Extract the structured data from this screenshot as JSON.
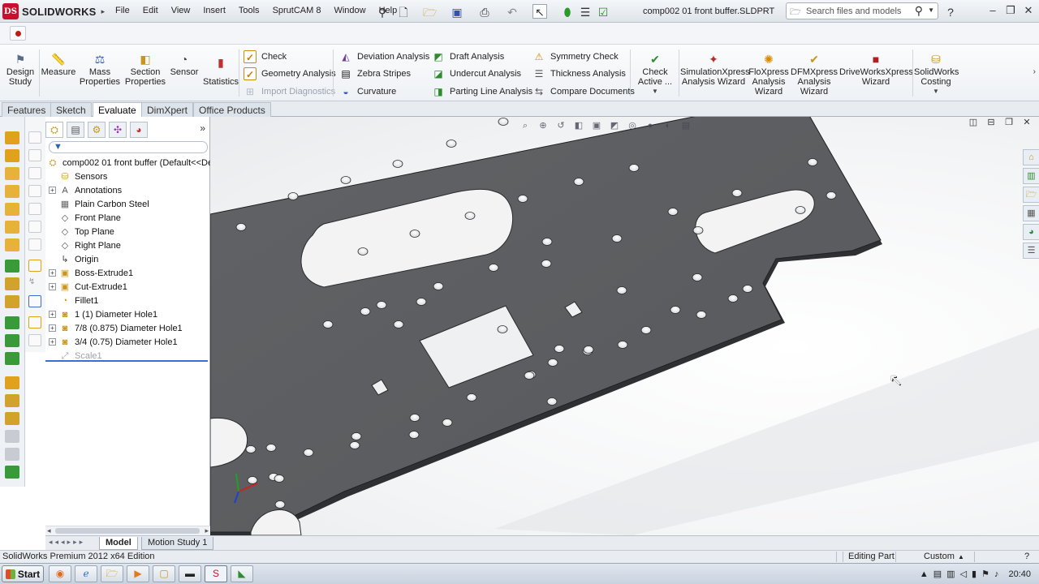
{
  "app": {
    "name": "SOLIDWORKS",
    "logo_mark": "DS",
    "document_title": "comp002 01 front buffer.SLDPRT"
  },
  "menu": [
    "File",
    "Edit",
    "View",
    "Insert",
    "Tools",
    "SprutCAM 8",
    "Window",
    "Help"
  ],
  "search": {
    "placeholder": "Search files and models"
  },
  "ribbon": {
    "large_buttons": [
      {
        "label1": "Design",
        "label2": "Study",
        "icon": "design-study-icon"
      },
      {
        "label1": "Measure",
        "label2": "",
        "icon": "measure-icon"
      },
      {
        "label1": "Mass",
        "label2": "Properties",
        "icon": "mass-properties-icon"
      },
      {
        "label1": "Section",
        "label2": "Properties",
        "icon": "section-properties-icon"
      },
      {
        "label1": "Sensor",
        "label2": "",
        "icon": "sensor-icon"
      },
      {
        "label1": "Statistics",
        "label2": "",
        "icon": "statistics-icon"
      }
    ],
    "col1": [
      {
        "label": "Check",
        "icon": "check-icon",
        "enabled": true
      },
      {
        "label": "Geometry Analysis",
        "icon": "geometry-analysis-icon",
        "enabled": true
      },
      {
        "label": "Import Diagnostics",
        "icon": "import-diagnostics-icon",
        "enabled": false
      }
    ],
    "col2": [
      {
        "label": "Deviation Analysis",
        "icon": "deviation-analysis-icon"
      },
      {
        "label": "Zebra Stripes",
        "icon": "zebra-stripes-icon"
      },
      {
        "label": "Curvature",
        "icon": "curvature-icon"
      }
    ],
    "col3": [
      {
        "label": "Draft Analysis",
        "icon": "draft-analysis-icon"
      },
      {
        "label": "Undercut Analysis",
        "icon": "undercut-analysis-icon"
      },
      {
        "label": "Parting Line Analysis",
        "icon": "parting-line-analysis-icon"
      }
    ],
    "col4": [
      {
        "label": "Symmetry Check",
        "icon": "symmetry-check-icon"
      },
      {
        "label": "Thickness Analysis",
        "icon": "thickness-analysis-icon"
      },
      {
        "label": "Compare Documents",
        "icon": "compare-documents-icon"
      }
    ],
    "wizards": [
      {
        "label1": "Check",
        "label2": "Active ...",
        "label3": "",
        "icon": "check-active-icon"
      },
      {
        "label1": "SimulationXpress",
        "label2": "Analysis Wizard",
        "label3": "",
        "icon": "simulationxpress-icon"
      },
      {
        "label1": "FloXpress",
        "label2": "Analysis",
        "label3": "Wizard",
        "icon": "floxpress-icon"
      },
      {
        "label1": "DFMXpress",
        "label2": "Analysis",
        "label3": "Wizard",
        "icon": "dfmxpress-icon"
      },
      {
        "label1": "DriveWorksXpress",
        "label2": "Wizard",
        "label3": "",
        "icon": "driveworksxpress-icon"
      },
      {
        "label1": "SolidWorks",
        "label2": "Costing",
        "label3": "",
        "icon": "costing-icon"
      }
    ]
  },
  "tabs": [
    {
      "label": "Features",
      "active": false
    },
    {
      "label": "Sketch",
      "active": false
    },
    {
      "label": "Evaluate",
      "active": true
    },
    {
      "label": "DimXpert",
      "active": false
    },
    {
      "label": "Office Products",
      "active": false
    }
  ],
  "tree": {
    "root": "comp002 01 front buffer  (Default<<De",
    "items": [
      {
        "label": "Sensors",
        "icon": "sensors-folder-icon",
        "expandable": false,
        "dim": false
      },
      {
        "label": "Annotations",
        "icon": "annotations-icon",
        "expandable": true,
        "dim": false
      },
      {
        "label": "Plain Carbon Steel",
        "icon": "material-icon",
        "expandable": false,
        "dim": false
      },
      {
        "label": "Front Plane",
        "icon": "plane-icon",
        "expandable": false,
        "dim": false
      },
      {
        "label": "Top Plane",
        "icon": "plane-icon",
        "expandable": false,
        "dim": false
      },
      {
        "label": "Right Plane",
        "icon": "plane-icon",
        "expandable": false,
        "dim": false
      },
      {
        "label": "Origin",
        "icon": "origin-icon",
        "expandable": false,
        "dim": false
      },
      {
        "label": "Boss-Extrude1",
        "icon": "boss-extrude-icon",
        "expandable": true,
        "dim": false
      },
      {
        "label": "Cut-Extrude1",
        "icon": "cut-extrude-icon",
        "expandable": true,
        "dim": false
      },
      {
        "label": "Fillet1",
        "icon": "fillet-icon",
        "expandable": false,
        "dim": false
      },
      {
        "label": "1 (1) Diameter Hole1",
        "icon": "hole-wizard-icon",
        "expandable": true,
        "dim": false
      },
      {
        "label": "7/8 (0.875) Diameter Hole1",
        "icon": "hole-wizard-icon",
        "expandable": true,
        "dim": false
      },
      {
        "label": "3/4 (0.75) Diameter Hole1",
        "icon": "hole-wizard-icon",
        "expandable": true,
        "dim": false
      },
      {
        "label": "Scale1",
        "icon": "scale-icon",
        "expandable": false,
        "dim": true
      }
    ]
  },
  "model_tabs": [
    {
      "label": "Model",
      "active": true
    },
    {
      "label": "Motion Study 1",
      "active": false
    }
  ],
  "status": {
    "edition": "SolidWorks Premium 2012 x64 Edition",
    "mode": "Editing Part",
    "units": "Custom"
  },
  "taskbar": {
    "start": "Start",
    "apps": [
      "firefox-icon",
      "ie-icon",
      "folder-icon",
      "media-player-icon",
      "explorer-icon",
      "terminal-icon",
      "solidworks-icon",
      "sprutcam-icon"
    ],
    "clock": "20:40"
  },
  "colors": {
    "part": "#5b5d60",
    "part_edge": "#2a2b2d",
    "hole_face": "#f2f2f2",
    "accent": "#c8102e"
  }
}
